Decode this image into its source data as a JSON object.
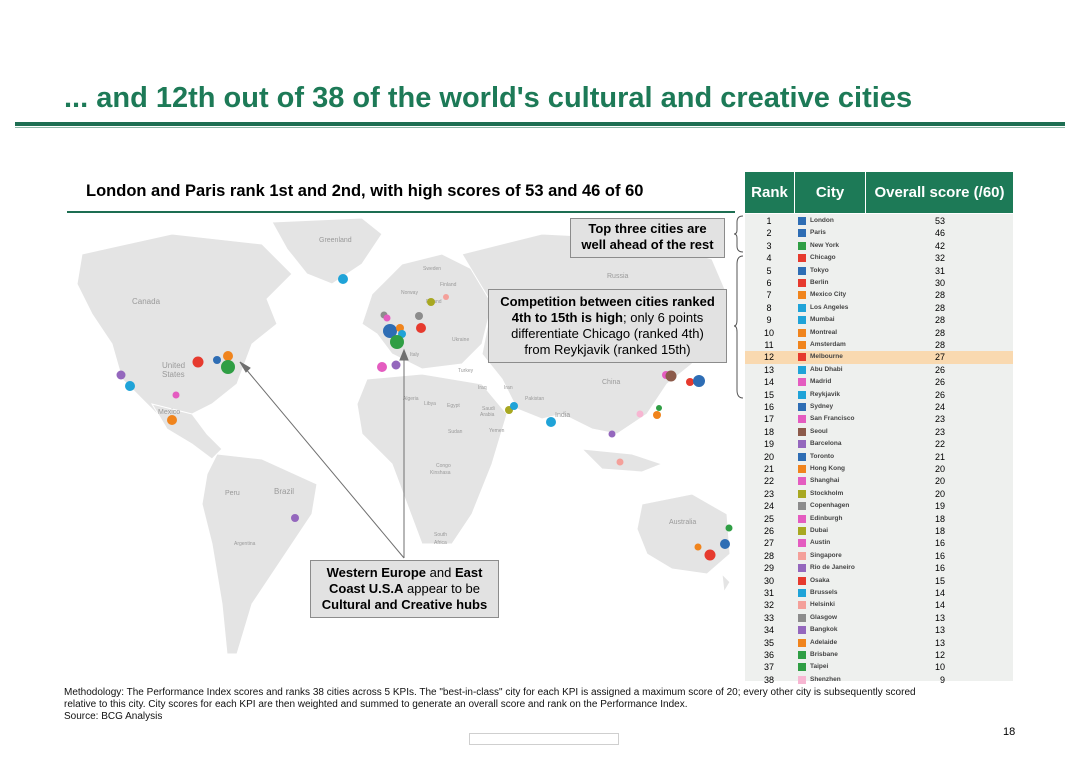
{
  "title": "... and 12th out of 38 of the world's cultural and creative cities",
  "subtitle": "London and Paris rank 1st and 2nd, with high scores of 53 and 46 of 60",
  "map": {
    "labels": {
      "greenland": "Greenland",
      "canada": "Canada",
      "united": "United",
      "states": "States",
      "mexico": "Mexico",
      "peru": "Peru",
      "brazil": "Brazil",
      "argentina": "Argentina",
      "russia": "Russia",
      "sweden": "Sweden",
      "finland": "Finland",
      "norway": "Norway",
      "poland": "Poland",
      "ukraine": "Ukraine",
      "italy": "Italy",
      "turkey": "Turkey",
      "iraq": "Iraq",
      "iran": "Iran",
      "algeria": "Algeria",
      "libya": "Libya",
      "egypt": "Egypt",
      "saudi": "Saudi",
      "arabia": "Arabia",
      "pakistan": "Pakistan",
      "india": "India",
      "china": "China",
      "sudan": "Sudan",
      "yemen": "Yemen",
      "congo": "Congo",
      "kinshasa": "Kinshasa",
      "south": "South",
      "africa": "Africa",
      "australia": "Australia"
    }
  },
  "callouts": {
    "top3": {
      "line1": "Top three cities are",
      "line2": "well ahead of the rest"
    },
    "competition": {
      "line1": "Competition between cities ranked",
      "line2_bold": "4th to 15th is high",
      "line2_rest": "; only 6 points",
      "line3": "differentiate Chicago (ranked 4th)",
      "line4": "from Reykjavik (ranked 15th)"
    },
    "hubs": {
      "l1_bold1": "Western Europe",
      "l1_mid": " and ",
      "l1_bold2": "East",
      "l2_bold": "Coast U.S.A",
      "l2_rest": " appear to be",
      "l3": "Cultural and Creative hubs"
    }
  },
  "table": {
    "headers": {
      "rank": "Rank",
      "city": "City",
      "score": "Overall score (/60)"
    },
    "highlight_rank": 12,
    "highlight_color": "#f9d9b0",
    "rows": [
      {
        "rank": "1",
        "city": "London",
        "score": "53",
        "color": "#2e6db4"
      },
      {
        "rank": "2",
        "city": "Paris",
        "score": "46",
        "color": "#2e6db4"
      },
      {
        "rank": "3",
        "city": "New York",
        "score": "42",
        "color": "#2f9e44"
      },
      {
        "rank": "4",
        "city": "Chicago",
        "score": "32",
        "color": "#e63a2e"
      },
      {
        "rank": "5",
        "city": "Tokyo",
        "score": "31",
        "color": "#2e6db4"
      },
      {
        "rank": "6",
        "city": "Berlin",
        "score": "30",
        "color": "#e63a2e"
      },
      {
        "rank": "7",
        "city": "Mexico City",
        "score": "28",
        "color": "#f0841d"
      },
      {
        "rank": "8",
        "city": "Los Angeles",
        "score": "28",
        "color": "#1fa3d8"
      },
      {
        "rank": "9",
        "city": "Mumbai",
        "score": "28",
        "color": "#1fa3d8"
      },
      {
        "rank": "10",
        "city": "Montreal",
        "score": "28",
        "color": "#f0841d"
      },
      {
        "rank": "11",
        "city": "Amsterdam",
        "score": "28",
        "color": "#f0841d"
      },
      {
        "rank": "12",
        "city": "Melbourne",
        "score": "27",
        "color": "#e63a2e"
      },
      {
        "rank": "13",
        "city": "Abu Dhabi",
        "score": "26",
        "color": "#1fa3d8"
      },
      {
        "rank": "14",
        "city": "Madrid",
        "score": "26",
        "color": "#e45cc0"
      },
      {
        "rank": "15",
        "city": "Reykjavik",
        "score": "26",
        "color": "#1fa3d8"
      },
      {
        "rank": "16",
        "city": "Sydney",
        "score": "24",
        "color": "#2e6db4"
      },
      {
        "rank": "17",
        "city": "San Francisco",
        "score": "23",
        "color": "#e45cc0"
      },
      {
        "rank": "18",
        "city": "Seoul",
        "score": "23",
        "color": "#8c5a4a"
      },
      {
        "rank": "19",
        "city": "Barcelona",
        "score": "22",
        "color": "#9467bd"
      },
      {
        "rank": "20",
        "city": "Toronto",
        "score": "21",
        "color": "#2e6db4"
      },
      {
        "rank": "21",
        "city": "Hong Kong",
        "score": "20",
        "color": "#f0841d"
      },
      {
        "rank": "22",
        "city": "Shanghai",
        "score": "20",
        "color": "#e45cc0"
      },
      {
        "rank": "23",
        "city": "Stockholm",
        "score": "20",
        "color": "#a8a821"
      },
      {
        "rank": "24",
        "city": "Copenhagen",
        "score": "19",
        "color": "#8c8c8c"
      },
      {
        "rank": "25",
        "city": "Edinburgh",
        "score": "18",
        "color": "#e45cc0"
      },
      {
        "rank": "26",
        "city": "Dubai",
        "score": "18",
        "color": "#a8a821"
      },
      {
        "rank": "27",
        "city": "Austin",
        "score": "16",
        "color": "#e45cc0"
      },
      {
        "rank": "28",
        "city": "Singapore",
        "score": "16",
        "color": "#f4a09a"
      },
      {
        "rank": "29",
        "city": "Rio de Janeiro",
        "score": "16",
        "color": "#9467bd"
      },
      {
        "rank": "30",
        "city": "Osaka",
        "score": "15",
        "color": "#e63a2e"
      },
      {
        "rank": "31",
        "city": "Brussels",
        "score": "14",
        "color": "#1fa3d8"
      },
      {
        "rank": "32",
        "city": "Helsinki",
        "score": "14",
        "color": "#f4a09a"
      },
      {
        "rank": "33",
        "city": "Glasgow",
        "score": "13",
        "color": "#8c8c8c"
      },
      {
        "rank": "34",
        "city": "Bangkok",
        "score": "13",
        "color": "#9467bd"
      },
      {
        "rank": "35",
        "city": "Adelaide",
        "score": "13",
        "color": "#f0841d"
      },
      {
        "rank": "36",
        "city": "Brisbane",
        "score": "12",
        "color": "#2f9e44"
      },
      {
        "rank": "37",
        "city": "Taipei",
        "score": "10",
        "color": "#2f9e44"
      },
      {
        "rank": "38",
        "city": "Shenzhen",
        "score": "9",
        "color": "#f7b6d2"
      }
    ]
  },
  "footnote": {
    "line1": "Methodology: The Performance Index scores and ranks 38 cities across 5 KPIs. The \"best-in-class\" city for each KPI is assigned a maximum score of 20; every other city is subsequently scored",
    "line2": "relative to this city. City scores for each KPI are then weighted and summed to generate an overall score and rank on the Performance Index.",
    "line3": "Source: BCG Analysis"
  },
  "page_number": "18"
}
